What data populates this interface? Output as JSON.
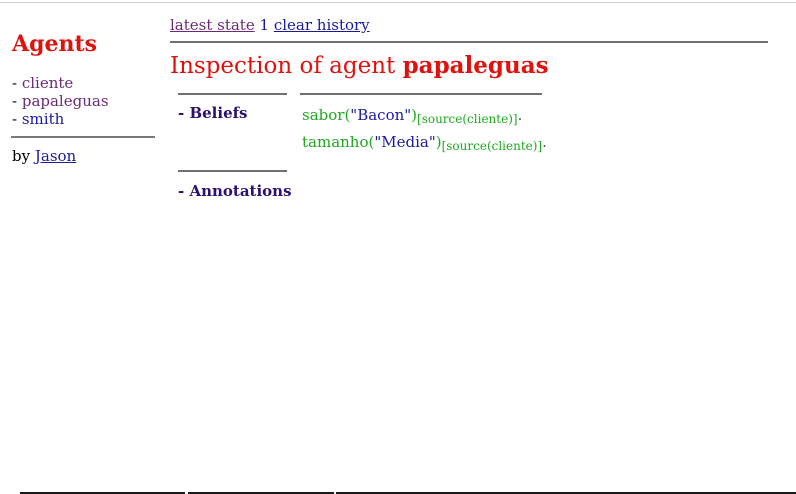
{
  "sidebar": {
    "title": "Agents",
    "items": [
      {
        "label": "cliente",
        "visited": true
      },
      {
        "label": "papaleguas",
        "visited": true
      },
      {
        "label": "smith",
        "visited": false
      }
    ],
    "by_prefix": "by",
    "by_link": "Jason"
  },
  "history": {
    "latest_label": "latest state",
    "count": "1",
    "clear_label": "clear history"
  },
  "inspection": {
    "prefix": "Inspection of agent",
    "agent": "papaleguas",
    "sections": [
      {
        "label": "- Beliefs"
      },
      {
        "label": "- Annotations"
      }
    ],
    "beliefs": [
      {
        "functor": "sabor(",
        "term": "\"Bacon\"",
        "close": ")",
        "annotation": "[source(cliente)]",
        "dot": "."
      },
      {
        "functor": "tamanho(",
        "term": "\"Media\"",
        "close": ")",
        "annotation": "[source(cliente)]",
        "dot": "."
      }
    ]
  },
  "colors": {
    "heading_red": "#e0120e",
    "visited_link": "#6b2a78",
    "link_blue": "#1a1a9c",
    "belief_green": "#1fa81f",
    "section_label": "#2a1070"
  }
}
